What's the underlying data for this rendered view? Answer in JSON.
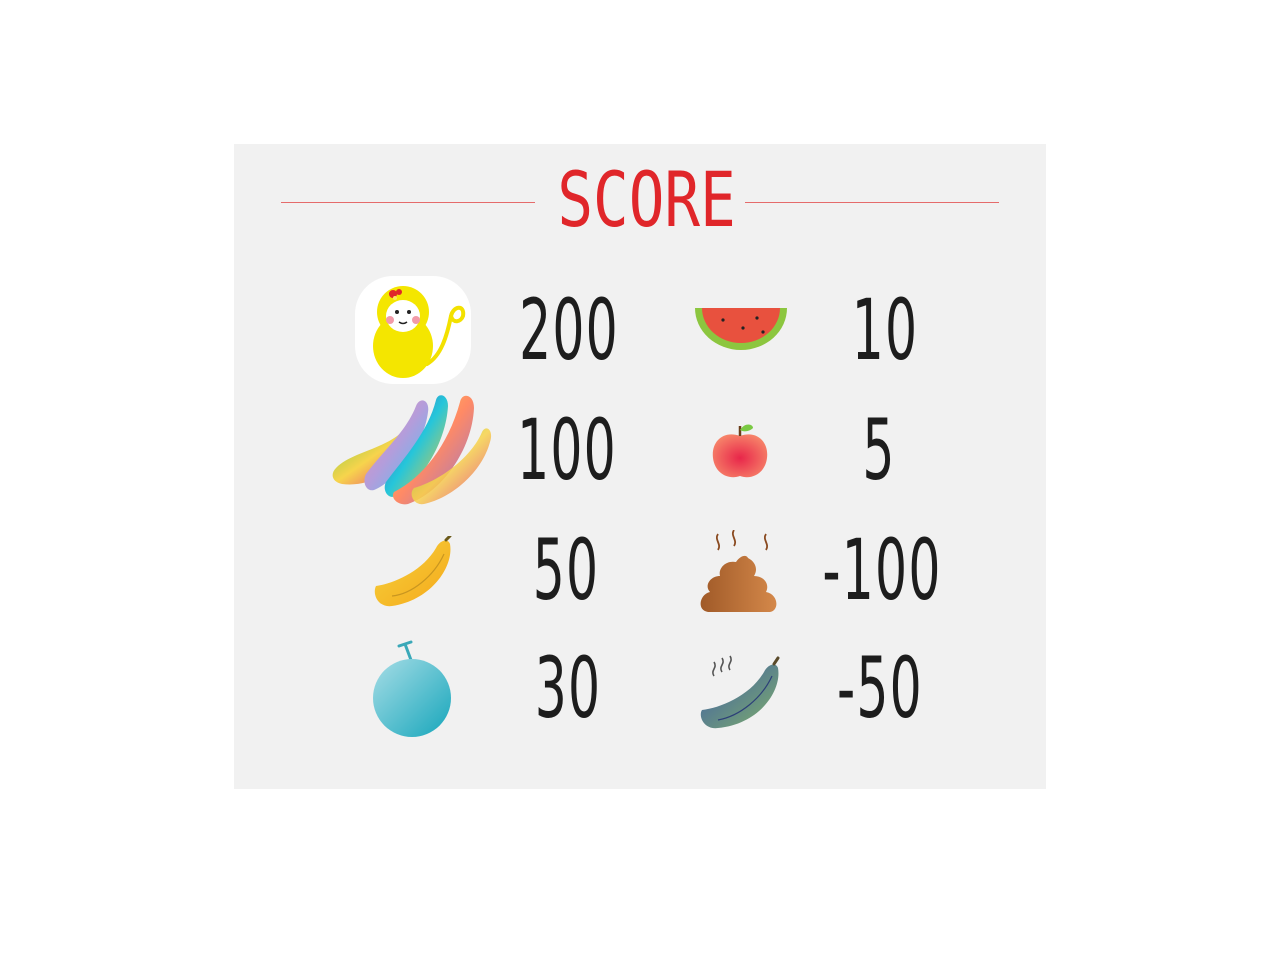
{
  "title": "SCORE",
  "colors": {
    "title": "#e0262a",
    "rule": "#e56b6b",
    "panel": "#f1f1f1",
    "text": "#1d1d1d"
  },
  "items": [
    {
      "icon": "monkey-icon",
      "points": "200"
    },
    {
      "icon": "rainbow-banana-bunch-icon",
      "points": "100"
    },
    {
      "icon": "banana-icon",
      "points": "50"
    },
    {
      "icon": "melon-icon",
      "points": "30"
    },
    {
      "icon": "watermelon-slice-icon",
      "points": "10"
    },
    {
      "icon": "peach-icon",
      "points": "5"
    },
    {
      "icon": "poop-icon",
      "points": "-100"
    },
    {
      "icon": "rotten-banana-icon",
      "points": "-50"
    }
  ]
}
